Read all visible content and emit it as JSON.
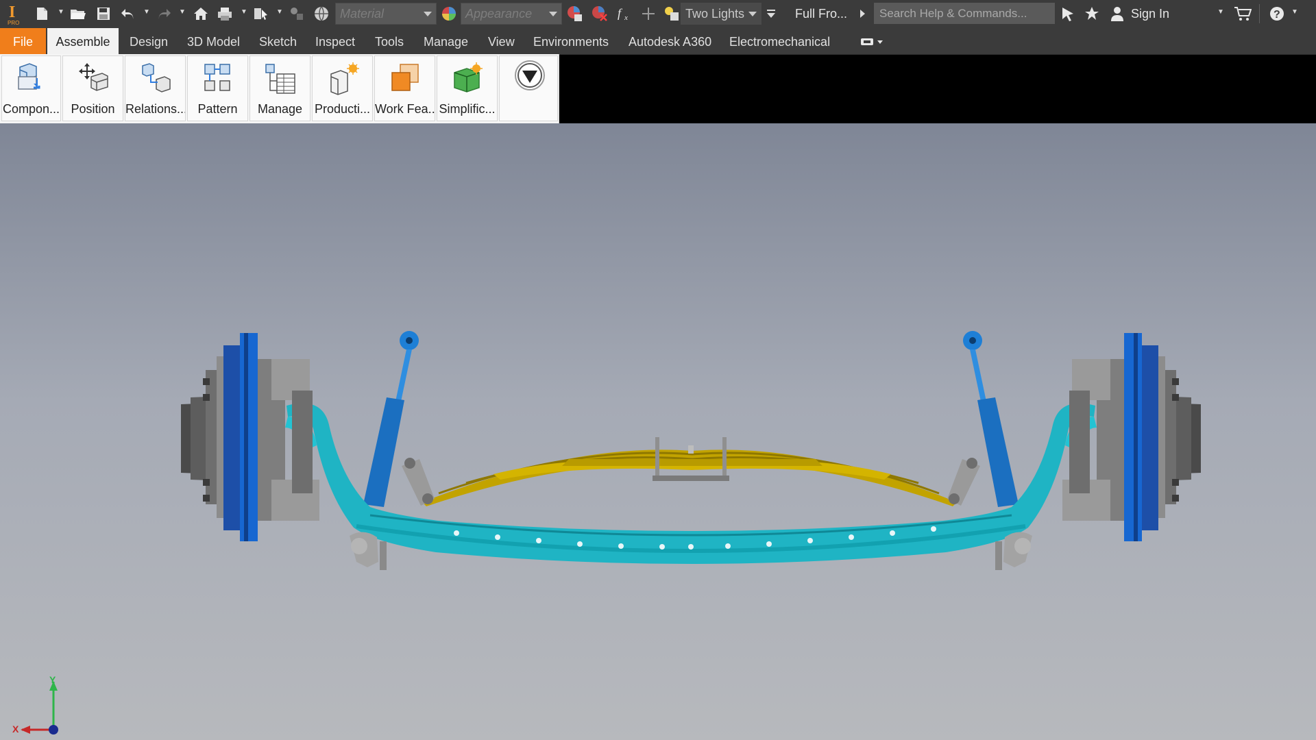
{
  "qat": {
    "material_placeholder": "Material",
    "appearance_placeholder": "Appearance",
    "lighting_label": "Two Lights",
    "view_label": "Full Fro...",
    "search_placeholder": "Search Help & Commands...",
    "sign_in_label": "Sign In"
  },
  "tabs": [
    {
      "label": "File"
    },
    {
      "label": "Assemble"
    },
    {
      "label": "Design"
    },
    {
      "label": "3D Model"
    },
    {
      "label": "Sketch"
    },
    {
      "label": "Inspect"
    },
    {
      "label": "Tools"
    },
    {
      "label": "Manage"
    },
    {
      "label": "View"
    },
    {
      "label": "Environments"
    },
    {
      "label": "Autodesk A360"
    },
    {
      "label": "Electromechanical"
    }
  ],
  "ribbon": {
    "buttons": [
      {
        "label": "Compon...",
        "icon": "component-place-icon"
      },
      {
        "label": "Position",
        "icon": "position-move-icon"
      },
      {
        "label": "Relations...",
        "icon": "relationships-icon"
      },
      {
        "label": "Pattern",
        "icon": "pattern-icon"
      },
      {
        "label": "Manage",
        "icon": "manage-bom-icon"
      },
      {
        "label": "Producti...",
        "icon": "productivity-icon"
      },
      {
        "label": "Work Fea...",
        "icon": "work-features-icon"
      },
      {
        "label": "Simplific...",
        "icon": "simplification-icon"
      }
    ]
  },
  "triad": {
    "x_label": "X",
    "y_label": "Y"
  },
  "colors": {
    "file_tab": "#f07e1b",
    "axle": "#1fb4c4",
    "disc": "#1767d1",
    "leaf_spring": "#c2a300",
    "shock": "#1e7fd6"
  }
}
